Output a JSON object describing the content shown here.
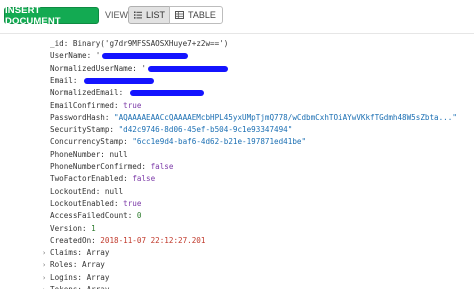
{
  "toolbar": {
    "insert_label": "INSERT DOCUMENT",
    "view_label": "VIEW",
    "list_label": "LIST",
    "table_label": "TABLE"
  },
  "document": {
    "fields": [
      {
        "key": "_id:",
        "value": "Binary('g7dr9MFSSAOSXHuye7+z2w==')",
        "type": "plain"
      },
      {
        "key": "UserName:",
        "value": "'",
        "type": "redacted"
      },
      {
        "key": "NormalizedUserName:",
        "value": "'",
        "type": "redacted"
      },
      {
        "key": "Email:",
        "value": "",
        "type": "redacted"
      },
      {
        "key": "NormalizedEmail:",
        "value": "",
        "type": "redacted"
      },
      {
        "key": "EmailConfirmed:",
        "value": "true",
        "type": "bool"
      },
      {
        "key": "PasswordHash:",
        "value": "\"AQAAAAEAACcQAAAAEMcbHPL45yxUMpTjmQ778/wCdbmCxhTOiAYwVKkfTGdmh48W5sZbta...\"",
        "type": "string"
      },
      {
        "key": "SecurityStamp:",
        "value": "\"d42c9746-8d06-45ef-b504-9c1e93347494\"",
        "type": "string"
      },
      {
        "key": "ConcurrencyStamp:",
        "value": "\"6cc1e9d4-baf6-4d62-b21e-197871ed41be\"",
        "type": "string"
      },
      {
        "key": "PhoneNumber:",
        "value": "null",
        "type": "plain"
      },
      {
        "key": "PhoneNumberConfirmed:",
        "value": "false",
        "type": "bool"
      },
      {
        "key": "TwoFactorEnabled:",
        "value": "false",
        "type": "bool"
      },
      {
        "key": "LockoutEnd:",
        "value": "null",
        "type": "plain"
      },
      {
        "key": "LockoutEnabled:",
        "value": "true",
        "type": "bool"
      },
      {
        "key": "AccessFailedCount:",
        "value": "0",
        "type": "number"
      },
      {
        "key": "Version:",
        "value": "1",
        "type": "number"
      },
      {
        "key": "CreatedOn:",
        "value": "2018-11-07 22:12:27.201",
        "type": "date"
      },
      {
        "key": "Claims:",
        "value": "Array",
        "type": "array"
      },
      {
        "key": "Roles:",
        "value": "Array",
        "type": "array"
      },
      {
        "key": "Logins:",
        "value": "Array",
        "type": "array"
      },
      {
        "key": "Tokens:",
        "value": "Array",
        "type": "array"
      }
    ]
  },
  "colors": {
    "insert_button": "#13aa52",
    "string_value": "#1b6fb3",
    "bool_value": "#7c3aa8",
    "date_value": "#c0392b",
    "redaction": "#1414ff"
  },
  "icons": {
    "list": "list-icon",
    "table": "table-icon",
    "expand": "chevron-right-icon"
  }
}
